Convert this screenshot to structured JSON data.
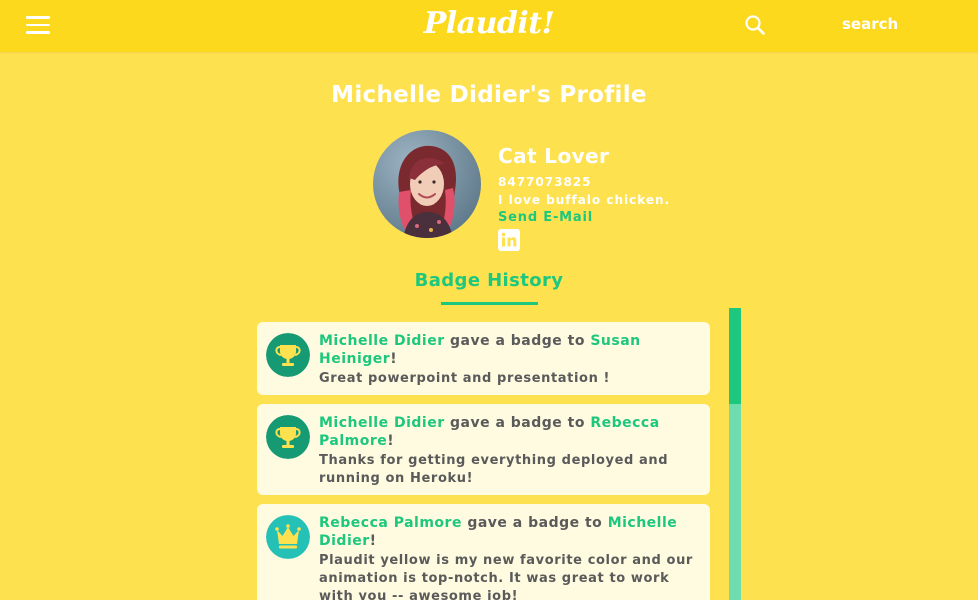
{
  "header": {
    "logo": "Plaudit!",
    "menu_icon": "hamburger-menu-icon",
    "search_icon": "search-icon",
    "search_label": "search"
  },
  "profile": {
    "page_title": "Michelle Didier's Profile",
    "name": "Cat Lover",
    "phone": "8477073825",
    "bio": "I love buffalo chicken.",
    "email_link": "Send E-Mail",
    "linkedin_icon": "linkedin-icon"
  },
  "badges": {
    "heading": "Badge History",
    "gave_text": " gave a badge to ",
    "items": [
      {
        "giver": "Michelle Didier",
        "receiver": "Susan Heiniger",
        "message": "Great powerpoint and presentation !",
        "icon": "trophy-icon"
      },
      {
        "giver": "Michelle Didier",
        "receiver": "Rebecca Palmore",
        "message": "Thanks for getting everything deployed and running on Heroku!",
        "icon": "trophy-icon"
      },
      {
        "giver": "Rebecca Palmore",
        "receiver": "Michelle Didier",
        "message": "Plaudit yellow is my new favorite color and our animation is top-notch. It was great to work with you -- awesome job!",
        "icon": "crown-icon"
      }
    ]
  },
  "colors": {
    "background": "#FEE14F",
    "header": "#FDD91E",
    "accent_green": "#1DC77E",
    "trophy_circle": "#159A73",
    "crown_circle": "#25C1B6",
    "card": "#FFFBE0",
    "text_gray": "#5A5A5A"
  }
}
